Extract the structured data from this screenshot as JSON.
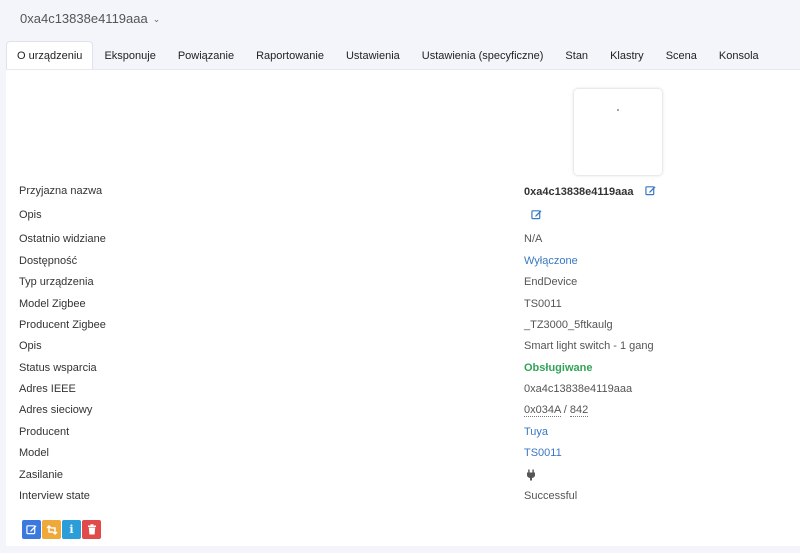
{
  "device": {
    "title": "0xa4c13838e4119aaa"
  },
  "tabs": [
    {
      "label": "O urządzeniu",
      "active": true
    },
    {
      "label": "Eksponuje"
    },
    {
      "label": "Powiązanie"
    },
    {
      "label": "Raportowanie"
    },
    {
      "label": "Ustawienia"
    },
    {
      "label": "Ustawienia (specyficzne)"
    },
    {
      "label": "Stan"
    },
    {
      "label": "Klastry"
    },
    {
      "label": "Scena"
    },
    {
      "label": "Konsola"
    }
  ],
  "info": {
    "friendly_name": {
      "label": "Przyjazna nazwa",
      "value": "0xa4c13838e4119aaa"
    },
    "description": {
      "label": "Opis"
    },
    "last_seen": {
      "label": "Ostatnio widziane",
      "value": "N/A"
    },
    "availability": {
      "label": "Dostępność",
      "value": "Wyłączone"
    },
    "device_type": {
      "label": "Typ urządzenia",
      "value": "EndDevice"
    },
    "zigbee_model": {
      "label": "Model Zigbee",
      "value": "TS0011"
    },
    "zigbee_manufacturer": {
      "label": "Producent Zigbee",
      "value": "_TZ3000_5ftkaulg"
    },
    "model_description": {
      "label": "Opis",
      "value": "Smart light switch - 1 gang"
    },
    "support_status": {
      "label": "Status wsparcia",
      "value": "Obsługiwane"
    },
    "ieee_address": {
      "label": "Adres IEEE",
      "value": "0xa4c13838e4119aaa"
    },
    "network_address": {
      "label": "Adres sieciowy",
      "hex": "0x034A",
      "separator": " / ",
      "dec": "842"
    },
    "manufacturer": {
      "label": "Producent",
      "value": "Tuya"
    },
    "model": {
      "label": "Model",
      "value": "TS0011"
    },
    "power": {
      "label": "Zasilanie",
      "icon": "plug-icon"
    },
    "interview_state": {
      "label": "Interview state",
      "value": "Successful"
    }
  },
  "actions": {
    "rename_icon": "edit-icon",
    "reconfigure_icon": "retweet-icon",
    "interview_icon": "info-icon",
    "remove_icon": "trash-icon"
  },
  "colors": {
    "link": "#3a78c3",
    "supported": "#33a35a",
    "btn_rename": "#3b79e0",
    "btn_reconfigure": "#efa83a",
    "btn_interview": "#2b9dd8",
    "btn_remove": "#e04a4a"
  }
}
